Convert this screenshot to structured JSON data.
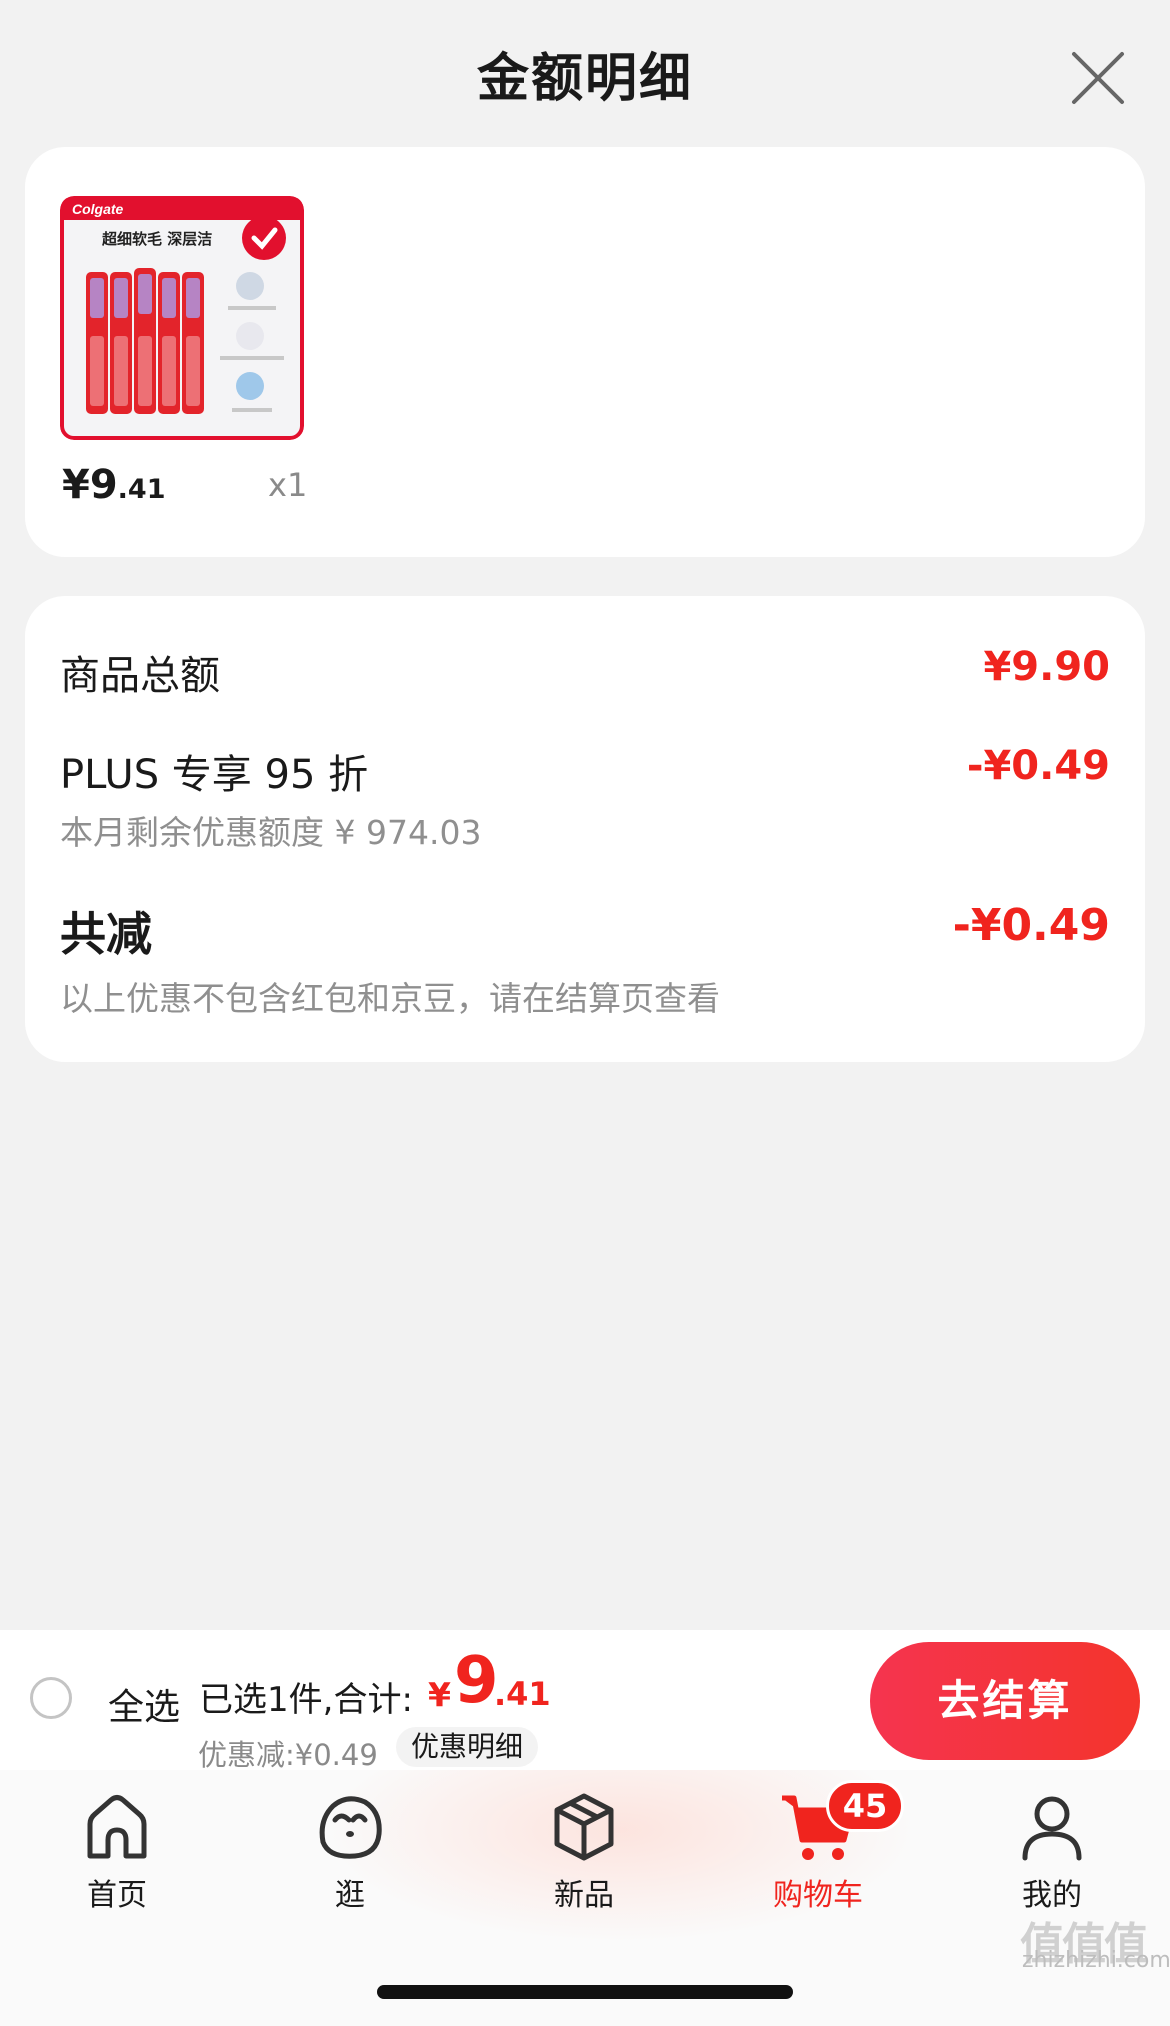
{
  "header": {
    "title": "金额明细"
  },
  "product": {
    "brand": "Colgate",
    "image_headline": "超细软毛  深层洁",
    "price_int": "¥9",
    "price_dec": ".41",
    "qty": "x1"
  },
  "detail": {
    "total_label": "商品总额",
    "total_value": "¥9.90",
    "plus_label": "PLUS 专享 95 折",
    "plus_value": "-¥0.49",
    "plus_sub": "本月剩余优惠额度 ¥ 974.03",
    "sum_label": "共减",
    "sum_value": "-¥0.49",
    "sum_note": "以上优惠不包含红包和京豆，请在结算页查看"
  },
  "checkout": {
    "select_all": "全选",
    "selected": "已选1件,合计:",
    "yen": "¥",
    "amount_int": "9",
    "amount_dec": ".41",
    "discount": "优惠减:¥0.49",
    "detail_chip": "优惠明细",
    "button": "去结算"
  },
  "tabs": [
    {
      "label": "首页",
      "icon": "home-icon"
    },
    {
      "label": "逛",
      "icon": "face-icon"
    },
    {
      "label": "新品",
      "icon": "box-icon"
    },
    {
      "label": "购物车",
      "icon": "cart-icon",
      "active": true
    },
    {
      "label": "我的",
      "icon": "user-icon"
    }
  ],
  "cart_badge": "45",
  "watermark": {
    "logo": "值值值",
    "text": "zhizhizhi.com"
  },
  "colors": {
    "accent": "#f0241e",
    "background": "#f2f2f2",
    "card": "#ffffff"
  }
}
